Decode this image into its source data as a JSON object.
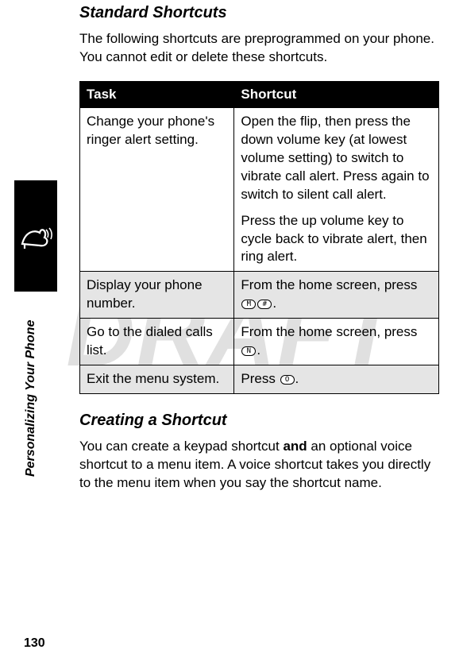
{
  "watermark": "DRAFT",
  "side_label": "Personalizing Your Phone",
  "page_number": "130",
  "section1": {
    "heading": "Standard Shortcuts",
    "intro": "The following shortcuts are preprogrammed on your phone. You cannot edit or delete these shortcuts."
  },
  "table": {
    "headers": {
      "task": "Task",
      "shortcut": "Shortcut"
    },
    "rows": [
      {
        "shaded": false,
        "task": "Change your phone's ringer alert setting.",
        "shortcut_paras": [
          "Open the flip, then press the down volume key (at lowest volume setting) to switch to vibrate call alert. Press again to switch to silent call alert.",
          "Press the up volume key to cycle back to vibrate alert, then ring alert."
        ]
      },
      {
        "shaded": true,
        "task": "Display your phone number.",
        "shortcut_prefix": "From the home screen, press ",
        "keys": [
          "M",
          "#"
        ],
        "shortcut_suffix": "."
      },
      {
        "shaded": false,
        "task": "Go to the dialed calls list.",
        "shortcut_prefix": "From the home screen, press ",
        "keys": [
          "N"
        ],
        "shortcut_suffix": "."
      },
      {
        "shaded": true,
        "task": "Exit the menu system.",
        "shortcut_prefix": "Press ",
        "keys": [
          "O"
        ],
        "shortcut_suffix": "."
      }
    ]
  },
  "section2": {
    "heading": "Creating a Shortcut",
    "intro_pre": "You can create a keypad shortcut ",
    "intro_bold": "and",
    "intro_post": " an optional voice shortcut to a menu item. A voice shortcut takes you directly to the menu item when you say the shortcut name."
  },
  "icons": {
    "side_tab": "ringer-vibrate-icon"
  }
}
